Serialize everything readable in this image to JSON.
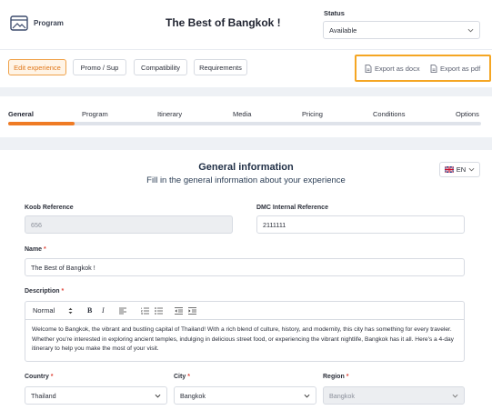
{
  "header": {
    "section_label": "Program",
    "title": "The Best of Bangkok !",
    "status_label": "Status",
    "status_value": "Available"
  },
  "actions": {
    "edit_experience": "Edit experience",
    "promo": "Promo / Sup",
    "compatibility": "Compatibility",
    "requirements": "Requirements",
    "export_docx": "Export as docx",
    "export_pdf": "Export as pdf"
  },
  "tabs": [
    "General",
    "Program",
    "Itinerary",
    "Media",
    "Pricing",
    "Conditions",
    "Options"
  ],
  "progress": {
    "active_tab": "General",
    "fraction": 0.14
  },
  "info": {
    "title": "General information",
    "subtitle": "Fill in the general information about your experience",
    "language": "EN"
  },
  "form": {
    "koob_label": "Koob Reference",
    "koob_value": "656",
    "dmc_label": "DMC Internal Reference",
    "dmc_value": "2111111",
    "name_label": "Name",
    "name_value": "The Best of Bangkok !",
    "description_label": "Description",
    "editor_style": "Normal",
    "description_text": "Welcome to Bangkok, the vibrant and bustling capital of Thailand! With a rich blend of culture, history, and modernity, this city has something for every traveler. Whether you're interested in exploring ancient temples, indulging in delicious street food, or experiencing the vibrant nightlife, Bangkok has it all. Here's a 4-day itinerary to help you make the most of your visit.",
    "country_label": "Country",
    "country_value": "Thailand",
    "city_label": "City",
    "city_value": "Bangkok",
    "region_label": "Region",
    "region_value": "Bangkok",
    "required_mark": "*"
  },
  "icons": {
    "program": "program-image-icon",
    "export": "document-icon",
    "chevron": "chevron-down-icon",
    "flag": "uk-flag-icon"
  },
  "colors": {
    "accent": "#ef7b24",
    "highlight_border": "#f5a623",
    "required": "#e0463a"
  }
}
